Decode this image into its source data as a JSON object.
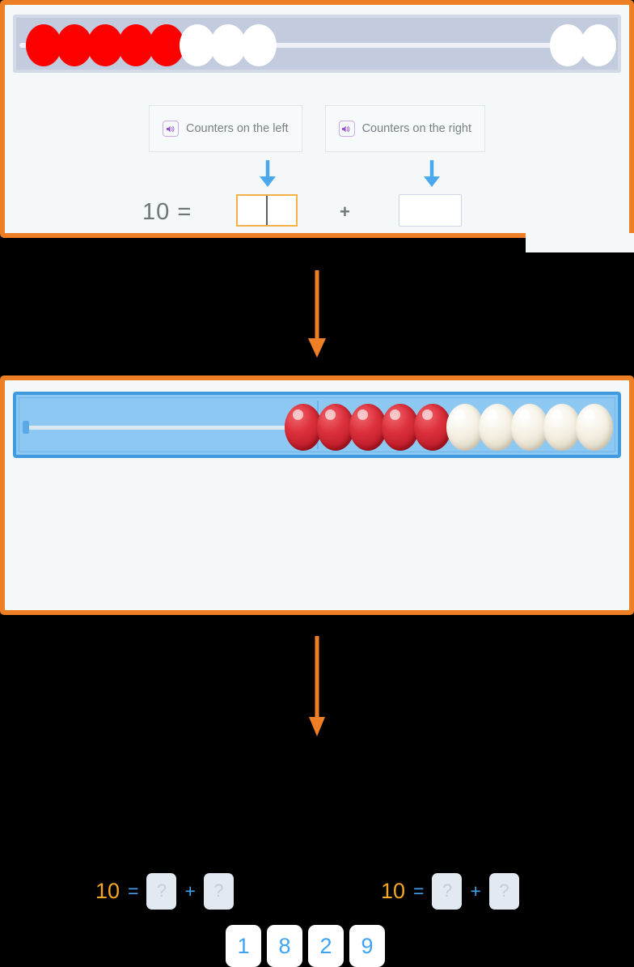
{
  "colors": {
    "panel_border": "#ef7f26",
    "panel_background": "#f4f8f9",
    "arrow_orange": "#ef7f26",
    "arrow_blue": "#4aa8ee",
    "bead_red_flat": "#fc0000",
    "bead_white_flat": "#ffffff",
    "bead_red_3d": "#dc2f3c",
    "bead_cream_3d": "#f6f2e6",
    "frame_blue": "#8dc8f3",
    "frame_blue_border": "#3f9ae0",
    "rack_gray": "#c3cbde",
    "number_blue": "#3fa3f5",
    "number_orange": "#f5a623",
    "focus_orange": "#f5b14a",
    "speaker_purple": "#cda9e8"
  },
  "panel_one": {
    "bead_rack": {
      "label": "bead-rack-top",
      "left_group": [
        {
          "color": "red"
        },
        {
          "color": "red"
        },
        {
          "color": "red"
        },
        {
          "color": "red"
        },
        {
          "color": "red"
        },
        {
          "color": "white"
        },
        {
          "color": "white"
        },
        {
          "color": "white"
        }
      ],
      "right_group": [
        {
          "color": "white"
        },
        {
          "color": "white"
        }
      ],
      "red_count": 5,
      "white_count": 5
    },
    "audio_buttons": [
      {
        "icon": "speaker-icon",
        "label": "Counters on the left"
      },
      {
        "icon": "speaker-icon",
        "label": "Counters on the right"
      }
    ],
    "arrows": [
      {
        "icon": "arrow-down-icon",
        "target": "left-input"
      },
      {
        "icon": "arrow-down-icon",
        "target": "right-input"
      }
    ],
    "equation": {
      "total": "10",
      "equals": "=",
      "plus": "+",
      "left_input_value": "",
      "left_input_placeholder": "",
      "left_input_focused": true,
      "right_input_value": "",
      "right_input_placeholder": ""
    }
  },
  "panel_two": {
    "bead_rack": {
      "label": "bead-rack-bottom",
      "beads": [
        {
          "color": "red"
        },
        {
          "color": "red"
        },
        {
          "color": "red"
        },
        {
          "color": "red"
        },
        {
          "color": "red"
        },
        {
          "color": "cream"
        },
        {
          "color": "cream"
        },
        {
          "color": "cream"
        },
        {
          "color": "cream"
        },
        {
          "color": "cream"
        }
      ],
      "red_count": 5,
      "cream_count": 5
    },
    "equations": [
      {
        "total": "10",
        "equals": "=",
        "plus": "+",
        "slot_one": "?",
        "slot_two": "?"
      },
      {
        "total": "10",
        "equals": "=",
        "plus": "+",
        "slot_one": "?",
        "slot_two": "?"
      }
    ],
    "number_tiles": [
      {
        "value": "1"
      },
      {
        "value": "8"
      },
      {
        "value": "2"
      },
      {
        "value": "9"
      }
    ]
  },
  "connectors": [
    {
      "icon": "arrow-down-icon",
      "position": "between-panels"
    },
    {
      "icon": "arrow-down-icon",
      "position": "below-panel-two"
    }
  ]
}
